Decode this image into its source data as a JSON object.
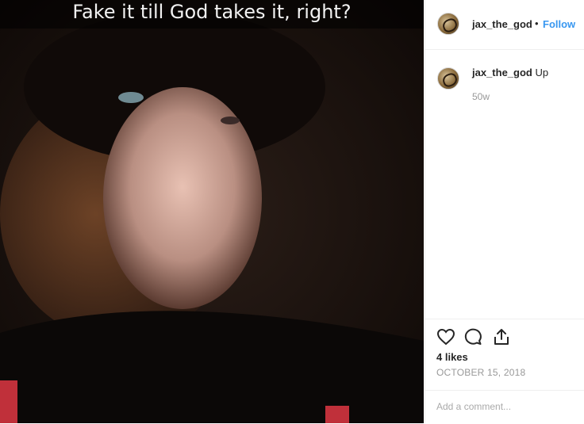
{
  "post": {
    "caption_overlay": "Fake it till God takes it, right?"
  },
  "header": {
    "username": "jax_the_god",
    "separator": "•",
    "follow_label": "Follow"
  },
  "comment": {
    "username": "jax_the_god",
    "text": "Up",
    "age": "50w"
  },
  "stats": {
    "likes": "4 likes",
    "date": "OCTOBER 15, 2018"
  },
  "composer": {
    "placeholder": "Add a comment..."
  },
  "colors": {
    "link": "#3897f0",
    "text": "#262626",
    "muted": "#999999"
  },
  "icons": [
    "heart-icon",
    "comment-icon",
    "share-icon"
  ]
}
